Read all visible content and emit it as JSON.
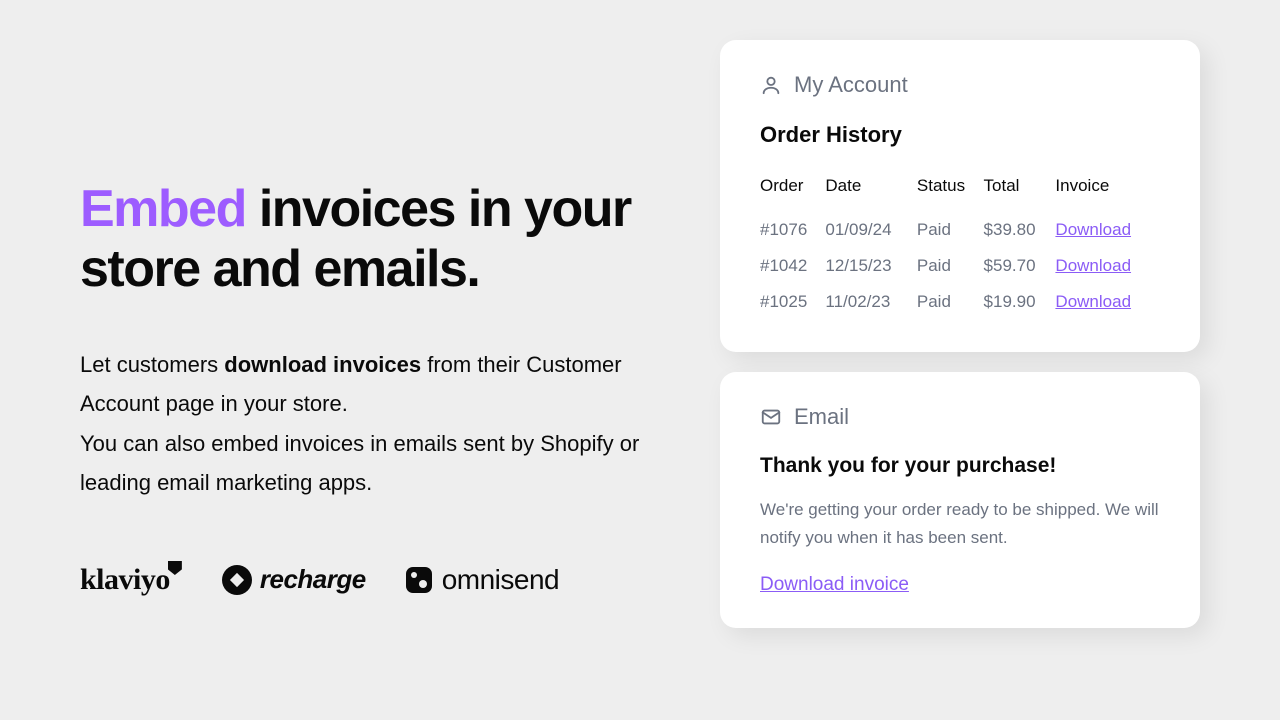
{
  "headline": {
    "accent": "Embed",
    "rest": " invoices in your store and emails."
  },
  "body": {
    "line1a": "Let customers ",
    "line1b": "download invoices",
    "line1c": " from their Customer Account page in your store.",
    "line2": "You can also embed invoices in emails sent by Shopify or leading email marketing apps."
  },
  "logos": {
    "klaviyo": "klaviyo",
    "recharge": "recharge",
    "omnisend": "omnisend"
  },
  "account_card": {
    "title": "My Account",
    "section": "Order History",
    "columns": {
      "order": "Order",
      "date": "Date",
      "status": "Status",
      "total": "Total",
      "invoice": "Invoice"
    },
    "rows": [
      {
        "order": "#1076",
        "date": "01/09/24",
        "status": "Paid",
        "total": "$39.80",
        "invoice": "Download"
      },
      {
        "order": "#1042",
        "date": "12/15/23",
        "status": "Paid",
        "total": "$59.70",
        "invoice": "Download"
      },
      {
        "order": "#1025",
        "date": "11/02/23",
        "status": "Paid",
        "total": "$19.90",
        "invoice": "Download"
      }
    ]
  },
  "email_card": {
    "title": "Email",
    "heading": "Thank you for your purchase!",
    "body": "We're getting your order ready to be shipped. We will notify you when it has been sent.",
    "link": "Download invoice"
  }
}
